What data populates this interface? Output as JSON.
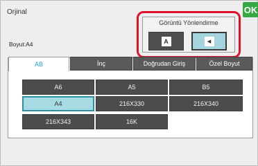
{
  "dialog": {
    "title": "Orjinal",
    "ok_label": "OK",
    "size_label": "Boyut:A4"
  },
  "orientation": {
    "label": "Görüntü Yönlendirme",
    "portrait_glyph": "A",
    "landscape_glyph": "◂",
    "selected": "landscape"
  },
  "tabs": [
    {
      "label": "AB",
      "active": true
    },
    {
      "label": "İnç",
      "active": false
    },
    {
      "label": "Doğrudan Giriş",
      "active": false
    },
    {
      "label": "Özel Boyut",
      "active": false
    }
  ],
  "sizes": [
    {
      "label": "A6",
      "selected": false
    },
    {
      "label": "A5",
      "selected": false
    },
    {
      "label": "B5",
      "selected": false
    },
    {
      "label": "A4",
      "selected": true
    },
    {
      "label": "216X330",
      "selected": false
    },
    {
      "label": "216X340",
      "selected": false
    },
    {
      "label": "216X343",
      "selected": false
    },
    {
      "label": "16K",
      "selected": false
    }
  ],
  "colors": {
    "ok_green": "#36a843",
    "highlight_red": "#e0102a",
    "selected_blue": "#a7dbe4",
    "tab_active_text": "#2a9bd0"
  }
}
